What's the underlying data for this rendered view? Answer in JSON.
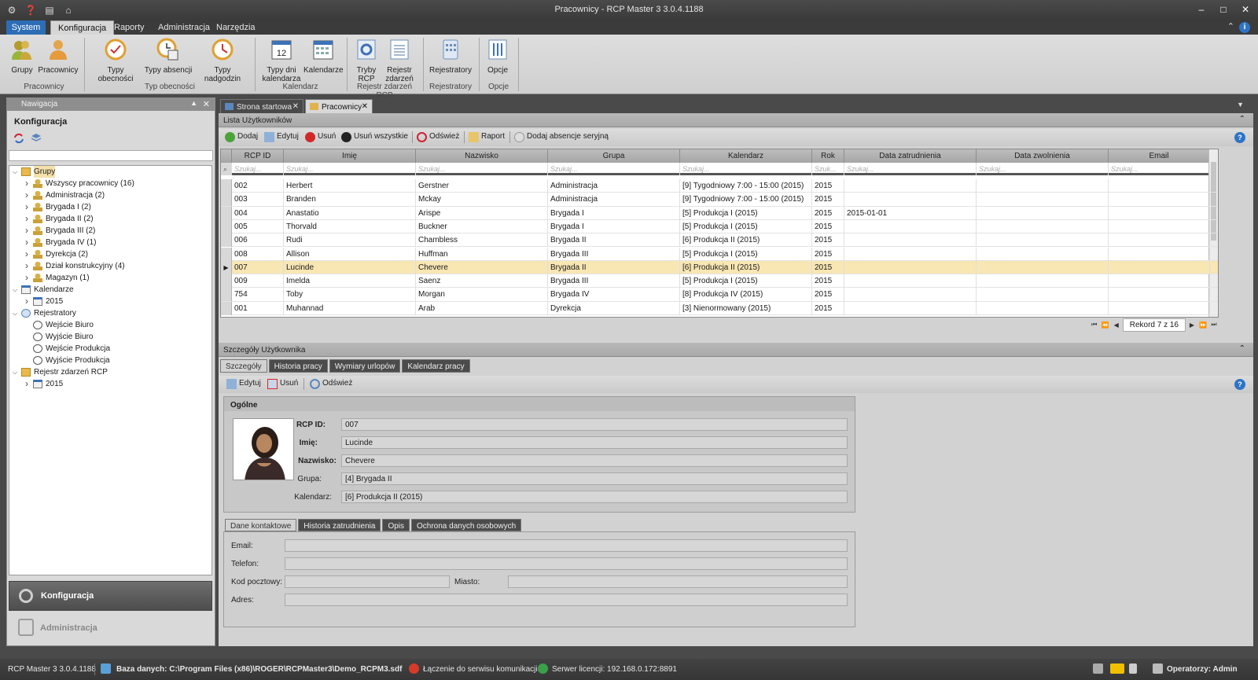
{
  "window": {
    "title": "Pracownicy - RCP Master 3 3.0.4.1188"
  },
  "ribbon": {
    "tabs": [
      "System",
      "Konfiguracja",
      "Raporty",
      "Administracja",
      "Narzędzia"
    ],
    "buttons": {
      "grupy": "Grupy",
      "pracownicy": "Pracownicy",
      "typy_obecnosci": "Typy obecności",
      "typy_absencji": "Typy absencji",
      "typy_nadgodzin": "Typy nadgodzin",
      "typy_dni_1": "Typy dni",
      "typy_dni_2": "kalendarza",
      "kalendarze": "Kalendarze",
      "tryby_1": "Tryby",
      "tryby_2": "RCP",
      "rejestr_1": "Rejestr",
      "rejestr_2": "zdarzeń",
      "rejestratory": "Rejestratory",
      "opcje": "Opcje",
      "cal_day": "12"
    },
    "groups": {
      "pracownicy": "Pracownicy",
      "typ_obecnosci": "Typ obecności",
      "kalendarz": "Kalendarz",
      "rejestr": "Rejestr zdarzeń RCP",
      "rejestratory": "Rejestratory",
      "opcje": "Opcje"
    }
  },
  "nav": {
    "header": "Nawigacja",
    "title": "Konfiguracja",
    "tree": [
      {
        "label": "Grupy",
        "level": 0,
        "exp": "v",
        "icon": "folder"
      },
      {
        "label": "Wszyscy pracownicy (16)",
        "level": 1,
        "exp": ">",
        "icon": "person"
      },
      {
        "label": "Administracja (2)",
        "level": 1,
        "exp": ">",
        "icon": "person"
      },
      {
        "label": "Brygada I (2)",
        "level": 1,
        "exp": ">",
        "icon": "person"
      },
      {
        "label": "Brygada II (2)",
        "level": 1,
        "exp": ">",
        "icon": "person"
      },
      {
        "label": "Brygada III (2)",
        "level": 1,
        "exp": ">",
        "icon": "person"
      },
      {
        "label": "Brygada IV (1)",
        "level": 1,
        "exp": ">",
        "icon": "person"
      },
      {
        "label": "Dyrekcja (2)",
        "level": 1,
        "exp": ">",
        "icon": "person"
      },
      {
        "label": "Dział konstrukcyjny (4)",
        "level": 1,
        "exp": ">",
        "icon": "person"
      },
      {
        "label": "Magazyn (1)",
        "level": 1,
        "exp": ">",
        "icon": "person"
      },
      {
        "label": "Kalendarze",
        "level": 0,
        "exp": "v",
        "icon": "cal"
      },
      {
        "label": "2015",
        "level": 1,
        "exp": ">",
        "icon": "cal"
      },
      {
        "label": "Rejestratory",
        "level": 0,
        "exp": "v",
        "icon": "reg"
      },
      {
        "label": "Wejście Biuro",
        "level": 1,
        "exp": "",
        "icon": "clock"
      },
      {
        "label": "Wyjście Biuro",
        "level": 1,
        "exp": "",
        "icon": "clock"
      },
      {
        "label": "Wejście Produkcja",
        "level": 1,
        "exp": "",
        "icon": "clock"
      },
      {
        "label": "Wyjście Produkcja",
        "level": 1,
        "exp": "",
        "icon": "clock"
      },
      {
        "label": "Rejestr zdarzeń RCP",
        "level": 0,
        "exp": "v",
        "icon": "folder"
      },
      {
        "label": "2015",
        "level": 1,
        "exp": ">",
        "icon": "cal"
      }
    ],
    "bottom": {
      "konfiguracja": "Konfiguracja",
      "administracja": "Administracja"
    }
  },
  "doctabs": [
    "Strona startowa",
    "Pracownicy"
  ],
  "list": {
    "title": "Lista Użytkowników",
    "toolbar": {
      "dodaj": "Dodaj",
      "edytuj": "Edytuj",
      "usun": "Usuń",
      "usun_wszystkie": "Usuń wszystkie",
      "odswiez": "Odśwież",
      "raport": "Raport",
      "dodaj_absencje": "Dodaj absencje seryjną"
    },
    "columns": [
      "RCP ID",
      "Imię",
      "Nazwisko",
      "Grupa",
      "Kalendarz",
      "Rok",
      "Data zatrudnienia",
      "Data zwolnienia",
      "Email"
    ],
    "filter_placeholder": "Szukaj...",
    "filter_placeholder_short": "Szuk...",
    "rows": [
      [
        "002",
        "Herbert",
        "Gerstner",
        "Administracja",
        "[9] Tygodniowy 7:00 - 15:00 (2015)",
        "2015",
        "",
        "",
        ""
      ],
      [
        "003",
        "Branden",
        "Mckay",
        "Administracja",
        "[9] Tygodniowy 7:00 - 15:00 (2015)",
        "2015",
        "",
        "",
        ""
      ],
      [
        "004",
        "Anastatio",
        "Arispe",
        "Brygada I",
        "[5] Produkcja I (2015)",
        "2015",
        "2015-01-01",
        "",
        ""
      ],
      [
        "005",
        "Thorvald",
        "Buckner",
        "Brygada I",
        "[5] Produkcja I (2015)",
        "2015",
        "",
        "",
        ""
      ],
      [
        "006",
        "Rudi",
        "Chambless",
        "Brygada II",
        "[6] Produkcja II (2015)",
        "2015",
        "",
        "",
        ""
      ],
      [
        "008",
        "Allison",
        "Huffman",
        "Brygada III",
        "[5] Produkcja I (2015)",
        "2015",
        "",
        "",
        ""
      ],
      [
        "007",
        "Lucinde",
        "Chevere",
        "Brygada II",
        "[6] Produkcja II (2015)",
        "2015",
        "",
        "",
        ""
      ],
      [
        "009",
        "Imelda",
        "Saenz",
        "Brygada III",
        "[5] Produkcja I (2015)",
        "2015",
        "",
        "",
        ""
      ],
      [
        "754",
        "Toby",
        "Morgan",
        "Brygada IV",
        "[8] Produkcja IV (2015)",
        "2015",
        "",
        "",
        ""
      ],
      [
        "001",
        "Muhannad",
        "Arab",
        "Dyrekcja",
        "[3] Nienormowany (2015)",
        "2015",
        "",
        "",
        ""
      ]
    ],
    "selected_row": 6,
    "pager": "Rekord 7 z 16"
  },
  "details": {
    "title": "Szczegóły Użytkownika",
    "tabs": [
      "Szczegóły",
      "Historia pracy",
      "Wymiary urlopów",
      "Kalendarz pracy"
    ],
    "toolbar": {
      "edytuj": "Edytuj",
      "usun": "Usuń",
      "odswiez": "Odśwież"
    },
    "panel_title": "Ogólne",
    "fields": {
      "rcp_id_label": "RCP ID:",
      "rcp_id": "007",
      "imie_label": "Imię:",
      "imie": "Lucinde",
      "nazwisko_label": "Nazwisko:",
      "nazwisko": "Chevere",
      "grupa_label": "Grupa:",
      "grupa": "[4] Brygada II",
      "kalendarz_label": "Kalendarz:",
      "kalendarz": "[6] Produkcja II (2015)"
    },
    "contact_tabs": [
      "Dane kontaktowe",
      "Historia zatrudnienia",
      "Opis",
      "Ochrona danych osobowych"
    ],
    "contact": {
      "email_label": "Email:",
      "telefon_label": "Telefon:",
      "kod_label": "Kod pocztowy:",
      "miasto_label": "Miasto:",
      "adres_label": "Adres:"
    }
  },
  "statusbar": {
    "version": "RCP Master 3 3.0.4.1188",
    "db": "Baza danych: C:\\Program Files (x86)\\ROGER\\RCPMaster3\\Demo_RCPM3.sdf",
    "service": "Łączenie do serwisu komunikacji...",
    "license": "Serwer licencji: 192.168.0.172:8891",
    "operators": "Operatorzy: Admin"
  },
  "colors": {
    "accent": "#2d6db5",
    "selection": "#f8e6b3",
    "chrome_dark": "#3b3b3b"
  }
}
